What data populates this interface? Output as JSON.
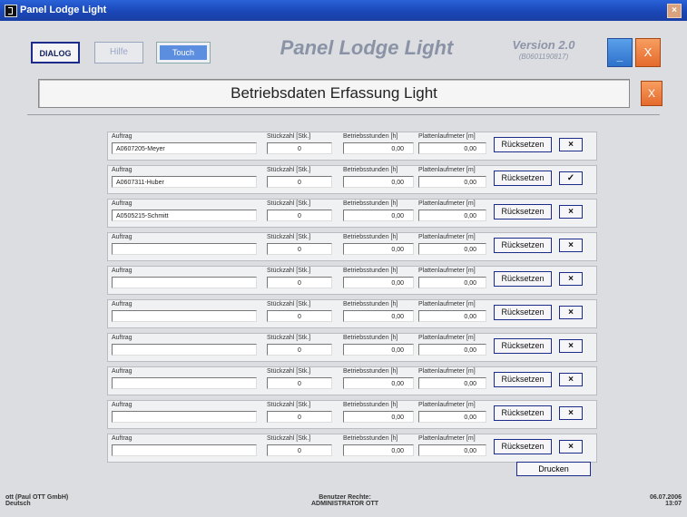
{
  "window": {
    "title": "Panel Lodge Light",
    "close_symbol": "×"
  },
  "toolbar": {
    "dialog_label": "DIALOG",
    "hilfe_label": "Hilfe",
    "touch_label": "Touch",
    "app_title": "Panel Lodge Light",
    "version": "Version 2.0",
    "build": "(B0601190817)",
    "minimize_symbol": "_",
    "close_symbol": "X"
  },
  "subheader": {
    "title": "Betriebsdaten Erfassung Light",
    "close_symbol": "X"
  },
  "columns": {
    "auftrag": "Auftrag",
    "stueckzahl": "Stückzahl [Stk.]",
    "betriebsstunden": "Betriebsstunden [h]",
    "plattenlaufmeter": "Plattenlaufmeter [m]"
  },
  "reset_label": "Rücksetzen",
  "rows": [
    {
      "auftrag": "A0607205-Meyer",
      "stueckzahl": "0",
      "betriebsstunden": "0,00",
      "plattenlaufmeter": "0,00",
      "action": "×"
    },
    {
      "auftrag": "A0607311-Huber",
      "stueckzahl": "0",
      "betriebsstunden": "0,00",
      "plattenlaufmeter": "0,00",
      "action": "✓"
    },
    {
      "auftrag": "A0505215-Schmitt",
      "stueckzahl": "0",
      "betriebsstunden": "0,00",
      "plattenlaufmeter": "0,00",
      "action": "×"
    },
    {
      "auftrag": "",
      "stueckzahl": "0",
      "betriebsstunden": "0,00",
      "plattenlaufmeter": "0,00",
      "action": "×"
    },
    {
      "auftrag": "",
      "stueckzahl": "0",
      "betriebsstunden": "0,00",
      "plattenlaufmeter": "0,00",
      "action": "×"
    },
    {
      "auftrag": "",
      "stueckzahl": "0",
      "betriebsstunden": "0,00",
      "plattenlaufmeter": "0,00",
      "action": "×"
    },
    {
      "auftrag": "",
      "stueckzahl": "0",
      "betriebsstunden": "0,00",
      "plattenlaufmeter": "0,00",
      "action": "×"
    },
    {
      "auftrag": "",
      "stueckzahl": "0",
      "betriebsstunden": "0,00",
      "plattenlaufmeter": "0,00",
      "action": "×"
    },
    {
      "auftrag": "",
      "stueckzahl": "0",
      "betriebsstunden": "0,00",
      "plattenlaufmeter": "0,00",
      "action": "×"
    },
    {
      "auftrag": "",
      "stueckzahl": "0",
      "betriebsstunden": "0,00",
      "plattenlaufmeter": "0,00",
      "action": "×"
    }
  ],
  "print_label": "Drucken",
  "footer": {
    "user": "ott (Paul OTT GmbH)",
    "language": "Deutsch",
    "rights_label": "Benutzer Rechte:",
    "rights_value": "ADMINISTRATOR OTT",
    "date": "06.07.2006",
    "time": "13:07"
  }
}
